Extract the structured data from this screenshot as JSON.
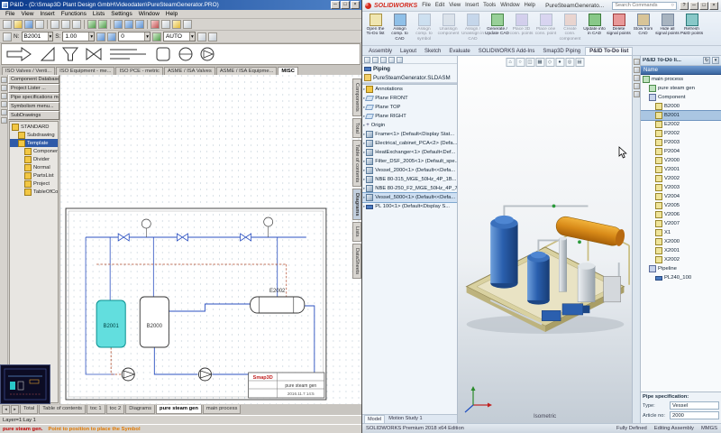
{
  "chrome": {
    "min": "─",
    "max": "□",
    "close": "×",
    "help": "?"
  },
  "pid": {
    "title": "P&ID - (D:\\Smap3D Plant Design GmbH\\Videodaten\\PureSteamGenerator.PRO)",
    "menus": [
      "File",
      "View",
      "Insert",
      "Functions",
      "Lists",
      "Settings",
      "Window",
      "Help"
    ],
    "toolbar": {
      "n_label": "N:",
      "component_value": "B2001",
      "s_label": "S:",
      "scale_value": "1.00",
      "angle_value": "0",
      "mode_value": "AUTO"
    },
    "symbol_tabs": [
      {
        "label": "ISO Valves / Venti...",
        "active": false
      },
      {
        "label": "ISO Equipment - me...",
        "active": false
      },
      {
        "label": "ISO PCE - metric",
        "active": false
      },
      {
        "label": "ASME / ISA Valves",
        "active": false
      },
      {
        "label": "ASME / ISA Equipme...",
        "active": false
      },
      {
        "label": "MISC",
        "active": true
      }
    ],
    "sidebar_buttons": [
      "Component Database...",
      "Project Lister ...",
      "Pipe specifications menu...",
      "Symbolism menu...",
      "SubDrawings"
    ],
    "sidebar_tree": [
      {
        "label": "STANDARD",
        "level": 0,
        "icon": "folder"
      },
      {
        "label": "Subdrawing",
        "level": 1,
        "icon": "folder"
      },
      {
        "label": "Template",
        "level": 1,
        "icon": "folder",
        "selected": true
      },
      {
        "label": "Components",
        "level": 2,
        "icon": "folder"
      },
      {
        "label": "Divider",
        "level": 2,
        "icon": "folder"
      },
      {
        "label": "Normal",
        "level": 2,
        "icon": "folder"
      },
      {
        "label": "PartsList",
        "level": 2,
        "icon": "folder"
      },
      {
        "label": "Project",
        "level": 2,
        "icon": "folder"
      },
      {
        "label": "TableOfContent",
        "level": 2,
        "icon": "folder"
      }
    ],
    "side_tabs": [
      {
        "label": "Components"
      },
      {
        "label": "Total"
      },
      {
        "label": "Table of contents"
      },
      {
        "label": "Diagrams",
        "active": true
      },
      {
        "label": "Lists"
      },
      {
        "label": "DataSheets"
      }
    ],
    "diagram": {
      "vessel1": "B2001",
      "vessel2": "B2000",
      "exchanger": "E2002",
      "title_block": {
        "brand": "Smap3D",
        "doc": "pure steam gen",
        "date": "2016.11.7  14:5"
      }
    },
    "bottom_tabs": [
      {
        "label": "Total"
      },
      {
        "label": "Table of contents"
      },
      {
        "label": "toc 1"
      },
      {
        "label": "toc 2"
      },
      {
        "label": "Diagrams"
      },
      {
        "label": "pure steam gen",
        "active": true
      },
      {
        "label": "main process"
      }
    ],
    "status": {
      "layer": "Layer=1:Lay 1",
      "doc": "pure steam gen.",
      "hint": "Point to position to place the Symbol"
    }
  },
  "sw": {
    "brand": "SOLIDWORKS",
    "menus": [
      "File",
      "Edit",
      "View",
      "Insert",
      "Tools",
      "Window",
      "Help"
    ],
    "doc_title": "PureSteamGenerato...",
    "search_placeholder": "Search Commands",
    "ribbon": [
      {
        "label": "Open the To-Do list",
        "icon": "r-todo"
      },
      {
        "label": "Assign comp. to CAD",
        "icon": "r-assign"
      },
      {
        "label": "Assign comp. to symbol",
        "icon": "r-assign-sym",
        "disabled": true
      },
      {
        "label": "Unassign component",
        "icon": "r-unassign",
        "disabled": true
      },
      {
        "label": "Assign / Unassign in CAD",
        "icon": "r-inout",
        "disabled": true
      },
      {
        "label": "Generate / Update CAD",
        "icon": "r-generate"
      },
      {
        "label": "Place 3D conn. points",
        "icon": "r-place3d",
        "disabled": true
      },
      {
        "label": "Place one conn. point",
        "icon": "r-place1",
        "disabled": true
      },
      {
        "label": "Create conn. component",
        "icon": "r-create",
        "disabled": true
      },
      {
        "label": "Update info in CAD",
        "icon": "r-update"
      },
      {
        "label": "Delete signal points",
        "icon": "r-delete"
      },
      {
        "label": "Stow from CAD",
        "icon": "r-stow"
      },
      {
        "label": "Hide all signal points",
        "icon": "r-hide"
      },
      {
        "label": "Refresh P&ID points",
        "icon": "r-refresh"
      }
    ],
    "tabs": [
      {
        "label": "Assembly"
      },
      {
        "label": "Layout"
      },
      {
        "label": "Sketch"
      },
      {
        "label": "Evaluate"
      },
      {
        "label": "SOLIDWORKS Add-Ins"
      },
      {
        "label": "Smap3D Piping"
      },
      {
        "label": "P&ID To-Do list",
        "active": true
      }
    ],
    "feature_panel": {
      "root1": "Piping",
      "root2": "PureSteamGenerator.SLDASM",
      "tree": [
        {
          "label": "Annotations",
          "icon": "folder"
        },
        {
          "label": "Plane FRONT",
          "icon": "plane"
        },
        {
          "label": "Plane TOP",
          "icon": "plane"
        },
        {
          "label": "Plane RIGHT",
          "icon": "plane"
        },
        {
          "label": "Origin",
          "icon": "origin"
        },
        {
          "label": "Frame<1> (Default<Display Stat...",
          "icon": "cube"
        },
        {
          "label": "Electrical_cabinet_PCA<2> (Defa...",
          "icon": "cube"
        },
        {
          "label": "HeatExchanger<1> (Default<Def...",
          "icon": "cube"
        },
        {
          "label": "Filter_DSF_2005<1> (Default_spe...",
          "icon": "cube"
        },
        {
          "label": "Vessel_2000<1> (Default<<Defa...",
          "icon": "cube"
        },
        {
          "label": "NBE 80-315_MGE_50Hz_4P_1B...",
          "icon": "cube"
        },
        {
          "label": "NBE 80-250_F2_MGE_50Hz_4P_7...",
          "icon": "cube"
        },
        {
          "label": "Vessel_5000<1> (Default<<Defa...",
          "icon": "cube",
          "selected": true
        },
        {
          "label": "PL 100<1> (Default<Display S...",
          "icon": "pipe"
        }
      ],
      "bottom_tabs": [
        "Model",
        "Motion Study 1"
      ]
    },
    "viewport": {
      "view_label": "Isometric"
    },
    "todo_panel": {
      "title": "P&ID To-Do li...",
      "column": "Name",
      "items": [
        {
          "label": "main process",
          "level": 0,
          "icon": "diagram"
        },
        {
          "label": "pure steam gen",
          "level": 1,
          "icon": "diagram"
        },
        {
          "label": "Component",
          "level": 1,
          "icon": "group"
        },
        {
          "label": "B2000",
          "level": 2,
          "icon": "part"
        },
        {
          "label": "B2001",
          "level": 2,
          "icon": "part",
          "selected": true
        },
        {
          "label": "E2002",
          "level": 2,
          "icon": "part"
        },
        {
          "label": "P2002",
          "level": 2,
          "icon": "part"
        },
        {
          "label": "P2003",
          "level": 2,
          "icon": "part"
        },
        {
          "label": "P2004",
          "level": 2,
          "icon": "part"
        },
        {
          "label": "V2000",
          "level": 2,
          "icon": "part"
        },
        {
          "label": "V2001",
          "level": 2,
          "icon": "part"
        },
        {
          "label": "V2002",
          "level": 2,
          "icon": "part"
        },
        {
          "label": "V2003",
          "level": 2,
          "icon": "part"
        },
        {
          "label": "V2004",
          "level": 2,
          "icon": "part"
        },
        {
          "label": "V2005",
          "level": 2,
          "icon": "part"
        },
        {
          "label": "V2006",
          "level": 2,
          "icon": "part"
        },
        {
          "label": "V2007",
          "level": 2,
          "icon": "part"
        },
        {
          "label": "X1",
          "level": 2,
          "icon": "part"
        },
        {
          "label": "X2000",
          "level": 2,
          "icon": "part"
        },
        {
          "label": "X2001",
          "level": 2,
          "icon": "part"
        },
        {
          "label": "X2002",
          "level": 2,
          "icon": "part"
        },
        {
          "label": "Pipeline",
          "level": 1,
          "icon": "group"
        },
        {
          "label": "PL240_100",
          "level": 2,
          "icon": "pipe"
        }
      ],
      "spec": {
        "title": "Pipe specification:",
        "type_label": "Type:",
        "type_value": "Vessel",
        "article_label": "Article no:",
        "article_value": "2000"
      }
    },
    "status": {
      "edition": "SOLIDWORKS Premium 2018 x64 Edition",
      "defined": "Fully Defined",
      "mode": "Editing Assembly",
      "units": "MMGS"
    }
  }
}
